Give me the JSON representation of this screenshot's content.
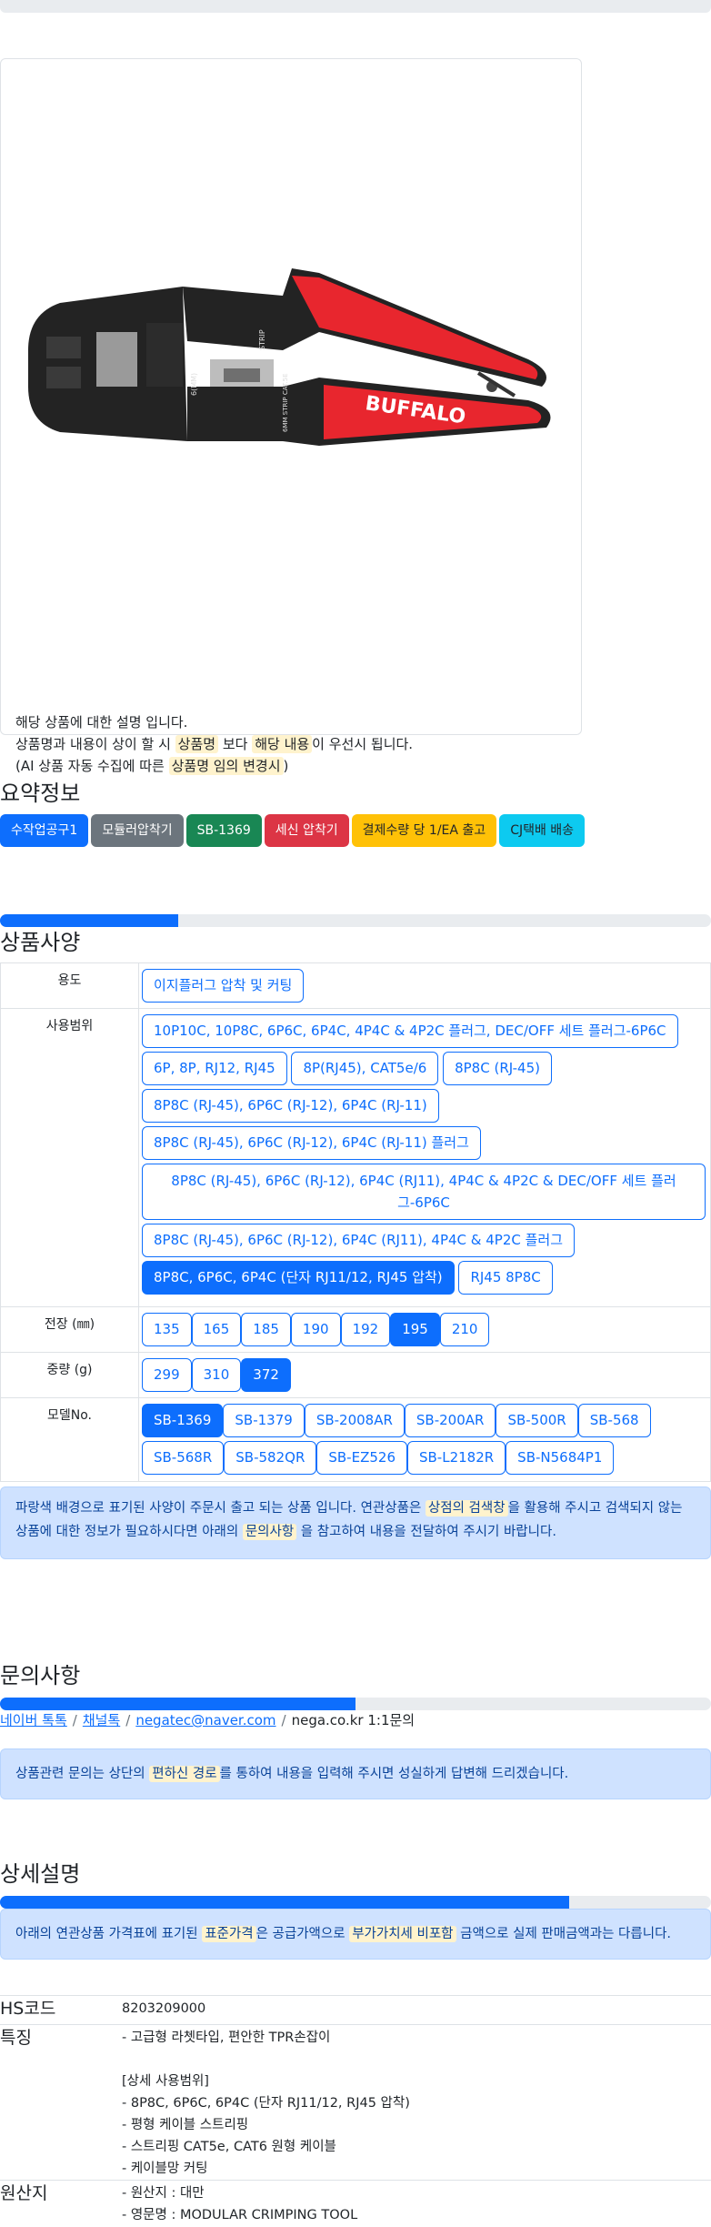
{
  "product": {
    "brand": "BUFFALO",
    "img_alt": "BUFFALO 모듈러 압착기 SB-1369",
    "tool_text": {
      "strip": "STRIP",
      "size_label": "6(MM)",
      "cat": "6MM STRIP CAT.5E"
    },
    "desc_line1": "해당 상품에 대한 설명 입니다.",
    "desc_line2_a": "상품명과 내용이 상이 할 시 ",
    "desc_line2_hl1": "상품명",
    "desc_line2_b": " 보다 ",
    "desc_line2_hl2": "해당 내용",
    "desc_line2_c": "이 우선시 됩니다.",
    "desc_line3_a": "(AI 상품 자동 수집에 따른 ",
    "desc_line3_hl": "상품명 임의 변경시",
    "desc_line3_b": ")"
  },
  "summary": {
    "title": "요약정보",
    "badges": [
      "수작업공구1",
      "모듈러압착기",
      "SB-1369",
      "세신 압착기",
      "결제수량 당 1/EA 출고",
      "CJ택배 배송"
    ]
  },
  "spec": {
    "title": "상품사양",
    "progress": 25,
    "rows": {
      "use_label": "용도",
      "use": [
        "이지플러그 압착 및 커팅"
      ],
      "range_label": "사용범위",
      "range": [
        "10P10C, 10P8C, 6P6C, 6P4C, 4P4C & 4P2C 플러그, DEC/OFF 세트 플러그-6P6C",
        "6P, 8P, RJ12, RJ45",
        "8P(RJ45), CAT5e/6",
        "8P8C (RJ-45)",
        "8P8C (RJ-45), 6P6C (RJ-12), 6P4C (RJ-11)",
        "8P8C (RJ-45), 6P6C (RJ-12), 6P4C (RJ-11) 플러그",
        "8P8C (RJ-45), 6P6C (RJ-12), 6P4C (RJ11), 4P4C & 4P2C & DEC/OFF 세트 플러그-6P6C",
        "8P8C (RJ-45), 6P6C (RJ-12), 6P4C (RJ11), 4P4C & 4P2C 플러그",
        "8P8C, 6P6C, 6P4C (단자 RJ11/12, RJ45 압착)",
        "RJ45 8P8C"
      ],
      "length_label": "전장 (㎜)",
      "length": [
        "135",
        "165",
        "185",
        "190",
        "192",
        "195",
        "210"
      ],
      "weight_label": "중량 (g)",
      "weight": [
        "299",
        "310",
        "372"
      ],
      "model_label": "모델No.",
      "model": [
        "SB-1369",
        "SB-1379",
        "SB-2008AR",
        "SB-200AR",
        "SB-500R",
        "SB-568",
        "SB-568R",
        "SB-582QR",
        "SB-EZ526",
        "SB-L2182R",
        "SB-N5684P1"
      ]
    },
    "note_a": "파랑색 배경으로 표기된 사양이 주문시 출고 되는 상품 입니다. 연관상품은 ",
    "note_hl1": "상점의 검색창",
    "note_b": "을 활용해 주시고 검색되지 않는 상품에 대한 정보가 필요하시다면 아래의 ",
    "note_hl2": "문의사항",
    "note_c": " 을 참고하여 내용을 전달하여 주시기 바랍니다."
  },
  "inquiry": {
    "title": "문의사항",
    "progress": 50,
    "links": [
      "네이버 톡톡",
      "채널톡",
      "negatec@naver.com"
    ],
    "sep": "/",
    "plain": "nega.co.kr 1:1문의",
    "note_a": "상품관련 문의는 상단의 ",
    "note_hl": "편하신 경로",
    "note_b": "를 통하여 내용을 입력해 주시면 성실하게 답변해 드리겠습니다."
  },
  "detail": {
    "title": "상세설명",
    "progress": 80,
    "note_a": "아래의 연관상품 가격표에 표기된 ",
    "note_hl1": "표준가격",
    "note_b": "은 공급가액으로 ",
    "note_hl2": "부가가치세 비포함",
    "note_c": " 금액으로 실제 판매금액과는 다릅니다.",
    "hs_label": "HS코드",
    "hs_value": "8203209000",
    "feature_label": "특징",
    "features": [
      "- 고급형 라쳇타입, 편안한 TPR손잡이",
      "",
      "[상세 사용범위]",
      "- 8P8C, 6P6C, 6P4C (단자 RJ11/12, RJ45 압착)",
      "- 평형 케이블 스트리핑",
      "- 스트리핑 CAT5e, CAT6 원형 케이블",
      "- 케이블망 커팅"
    ],
    "origin_label": "원산지",
    "origin": [
      "- 원산지 : 대만",
      "- 영문명 : MODULAR CRIMPING TOOL"
    ]
  },
  "colors": {
    "primary": "#0d6efd",
    "highlight": "#fff3cd",
    "tool_red": "#e8262e",
    "tool_black": "#232323"
  }
}
